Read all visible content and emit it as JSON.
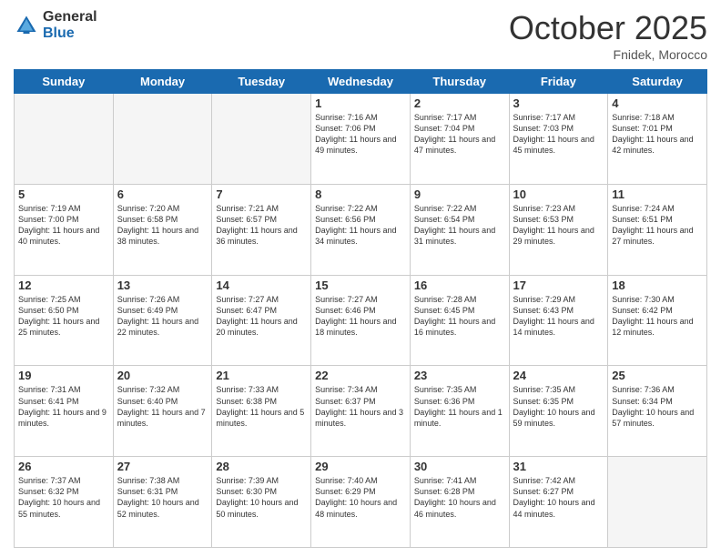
{
  "logo": {
    "general": "General",
    "blue": "Blue"
  },
  "header": {
    "month": "October 2025",
    "location": "Fnidek, Morocco"
  },
  "weekdays": [
    "Sunday",
    "Monday",
    "Tuesday",
    "Wednesday",
    "Thursday",
    "Friday",
    "Saturday"
  ],
  "weeks": [
    [
      {
        "day": "",
        "empty": true
      },
      {
        "day": "",
        "empty": true
      },
      {
        "day": "",
        "empty": true
      },
      {
        "day": "1",
        "sunrise": "Sunrise: 7:16 AM",
        "sunset": "Sunset: 7:06 PM",
        "daylight": "Daylight: 11 hours and 49 minutes."
      },
      {
        "day": "2",
        "sunrise": "Sunrise: 7:17 AM",
        "sunset": "Sunset: 7:04 PM",
        "daylight": "Daylight: 11 hours and 47 minutes."
      },
      {
        "day": "3",
        "sunrise": "Sunrise: 7:17 AM",
        "sunset": "Sunset: 7:03 PM",
        "daylight": "Daylight: 11 hours and 45 minutes."
      },
      {
        "day": "4",
        "sunrise": "Sunrise: 7:18 AM",
        "sunset": "Sunset: 7:01 PM",
        "daylight": "Daylight: 11 hours and 42 minutes."
      }
    ],
    [
      {
        "day": "5",
        "sunrise": "Sunrise: 7:19 AM",
        "sunset": "Sunset: 7:00 PM",
        "daylight": "Daylight: 11 hours and 40 minutes."
      },
      {
        "day": "6",
        "sunrise": "Sunrise: 7:20 AM",
        "sunset": "Sunset: 6:58 PM",
        "daylight": "Daylight: 11 hours and 38 minutes."
      },
      {
        "day": "7",
        "sunrise": "Sunrise: 7:21 AM",
        "sunset": "Sunset: 6:57 PM",
        "daylight": "Daylight: 11 hours and 36 minutes."
      },
      {
        "day": "8",
        "sunrise": "Sunrise: 7:22 AM",
        "sunset": "Sunset: 6:56 PM",
        "daylight": "Daylight: 11 hours and 34 minutes."
      },
      {
        "day": "9",
        "sunrise": "Sunrise: 7:22 AM",
        "sunset": "Sunset: 6:54 PM",
        "daylight": "Daylight: 11 hours and 31 minutes."
      },
      {
        "day": "10",
        "sunrise": "Sunrise: 7:23 AM",
        "sunset": "Sunset: 6:53 PM",
        "daylight": "Daylight: 11 hours and 29 minutes."
      },
      {
        "day": "11",
        "sunrise": "Sunrise: 7:24 AM",
        "sunset": "Sunset: 6:51 PM",
        "daylight": "Daylight: 11 hours and 27 minutes."
      }
    ],
    [
      {
        "day": "12",
        "sunrise": "Sunrise: 7:25 AM",
        "sunset": "Sunset: 6:50 PM",
        "daylight": "Daylight: 11 hours and 25 minutes."
      },
      {
        "day": "13",
        "sunrise": "Sunrise: 7:26 AM",
        "sunset": "Sunset: 6:49 PM",
        "daylight": "Daylight: 11 hours and 22 minutes."
      },
      {
        "day": "14",
        "sunrise": "Sunrise: 7:27 AM",
        "sunset": "Sunset: 6:47 PM",
        "daylight": "Daylight: 11 hours and 20 minutes."
      },
      {
        "day": "15",
        "sunrise": "Sunrise: 7:27 AM",
        "sunset": "Sunset: 6:46 PM",
        "daylight": "Daylight: 11 hours and 18 minutes."
      },
      {
        "day": "16",
        "sunrise": "Sunrise: 7:28 AM",
        "sunset": "Sunset: 6:45 PM",
        "daylight": "Daylight: 11 hours and 16 minutes."
      },
      {
        "day": "17",
        "sunrise": "Sunrise: 7:29 AM",
        "sunset": "Sunset: 6:43 PM",
        "daylight": "Daylight: 11 hours and 14 minutes."
      },
      {
        "day": "18",
        "sunrise": "Sunrise: 7:30 AM",
        "sunset": "Sunset: 6:42 PM",
        "daylight": "Daylight: 11 hours and 12 minutes."
      }
    ],
    [
      {
        "day": "19",
        "sunrise": "Sunrise: 7:31 AM",
        "sunset": "Sunset: 6:41 PM",
        "daylight": "Daylight: 11 hours and 9 minutes."
      },
      {
        "day": "20",
        "sunrise": "Sunrise: 7:32 AM",
        "sunset": "Sunset: 6:40 PM",
        "daylight": "Daylight: 11 hours and 7 minutes."
      },
      {
        "day": "21",
        "sunrise": "Sunrise: 7:33 AM",
        "sunset": "Sunset: 6:38 PM",
        "daylight": "Daylight: 11 hours and 5 minutes."
      },
      {
        "day": "22",
        "sunrise": "Sunrise: 7:34 AM",
        "sunset": "Sunset: 6:37 PM",
        "daylight": "Daylight: 11 hours and 3 minutes."
      },
      {
        "day": "23",
        "sunrise": "Sunrise: 7:35 AM",
        "sunset": "Sunset: 6:36 PM",
        "daylight": "Daylight: 11 hours and 1 minute."
      },
      {
        "day": "24",
        "sunrise": "Sunrise: 7:35 AM",
        "sunset": "Sunset: 6:35 PM",
        "daylight": "Daylight: 10 hours and 59 minutes."
      },
      {
        "day": "25",
        "sunrise": "Sunrise: 7:36 AM",
        "sunset": "Sunset: 6:34 PM",
        "daylight": "Daylight: 10 hours and 57 minutes."
      }
    ],
    [
      {
        "day": "26",
        "sunrise": "Sunrise: 7:37 AM",
        "sunset": "Sunset: 6:32 PM",
        "daylight": "Daylight: 10 hours and 55 minutes."
      },
      {
        "day": "27",
        "sunrise": "Sunrise: 7:38 AM",
        "sunset": "Sunset: 6:31 PM",
        "daylight": "Daylight: 10 hours and 52 minutes."
      },
      {
        "day": "28",
        "sunrise": "Sunrise: 7:39 AM",
        "sunset": "Sunset: 6:30 PM",
        "daylight": "Daylight: 10 hours and 50 minutes."
      },
      {
        "day": "29",
        "sunrise": "Sunrise: 7:40 AM",
        "sunset": "Sunset: 6:29 PM",
        "daylight": "Daylight: 10 hours and 48 minutes."
      },
      {
        "day": "30",
        "sunrise": "Sunrise: 7:41 AM",
        "sunset": "Sunset: 6:28 PM",
        "daylight": "Daylight: 10 hours and 46 minutes."
      },
      {
        "day": "31",
        "sunrise": "Sunrise: 7:42 AM",
        "sunset": "Sunset: 6:27 PM",
        "daylight": "Daylight: 10 hours and 44 minutes."
      },
      {
        "day": "",
        "empty": true
      }
    ]
  ]
}
